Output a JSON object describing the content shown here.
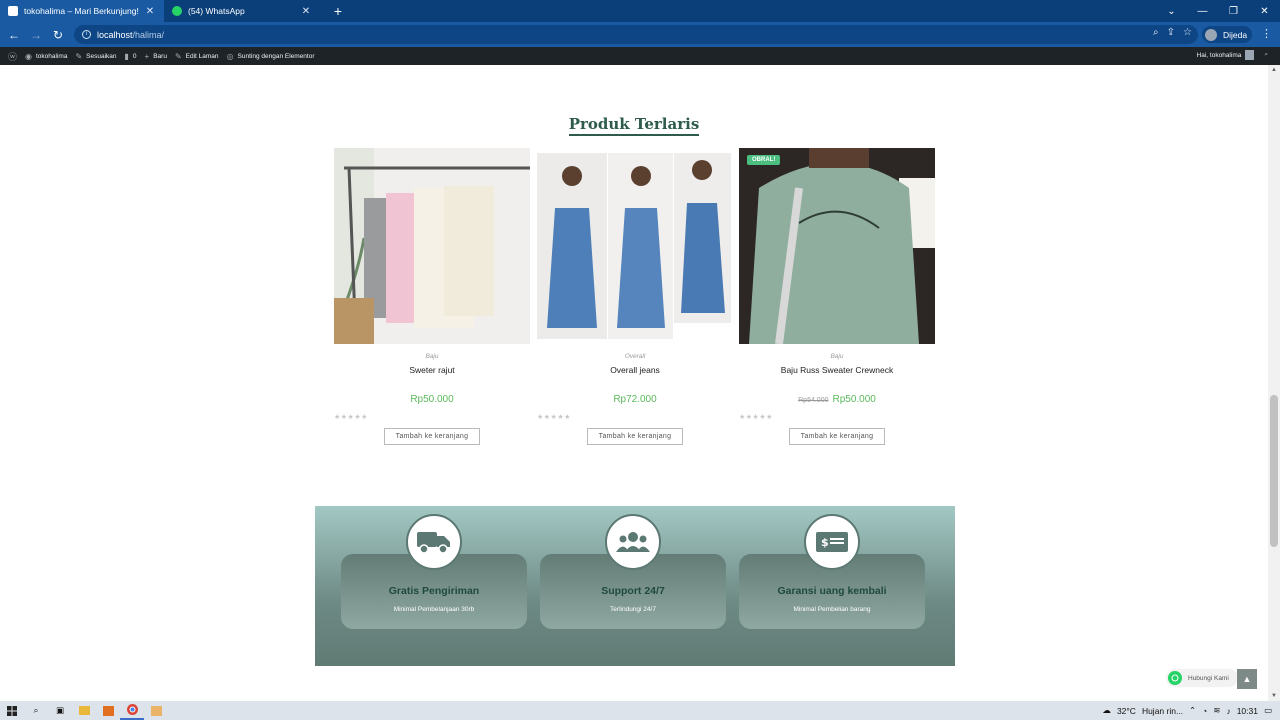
{
  "browser": {
    "tabs": [
      {
        "title": "tokohalima – Mari Berkunjung!",
        "active": true
      },
      {
        "title": "(54) WhatsApp",
        "active": false
      }
    ],
    "url_host": "localhost",
    "url_path": "/halima/",
    "profile_label": "Dijeda"
  },
  "admin_bar": {
    "site": "tokohalima",
    "customize": "Sesuaikan",
    "comments": "0",
    "new": "Baru",
    "edit": "Edit Laman",
    "elementor": "Sunting dengan Elementor",
    "greeting": "Hai, tokohalima"
  },
  "section": {
    "title": "Produk Terlaris"
  },
  "products": [
    {
      "category": "Baju",
      "name": "Sweter rajut",
      "price": "Rp50.000",
      "old_price": "",
      "rating": 0,
      "cart_label": "Tambah ke keranjang",
      "badge": ""
    },
    {
      "category": "Overall",
      "name": "Overall jeans",
      "price": "Rp72.000",
      "old_price": "",
      "rating": 0,
      "cart_label": "Tambah ke keranjang",
      "badge": ""
    },
    {
      "category": "Baju",
      "name": "Baju Russ Sweater Crewneck",
      "price": "Rp50.000",
      "old_price": "Rp54.000",
      "rating": 0,
      "cart_label": "Tambah ke keranjang",
      "badge": "OBRAL!"
    }
  ],
  "features": [
    {
      "icon": "truck-icon",
      "title": "Gratis Pengiriman",
      "subtitle": "Minimal Pembelanjaan 30rb"
    },
    {
      "icon": "users-icon",
      "title": "Support 24/7",
      "subtitle": "Terlindungi 24/7"
    },
    {
      "icon": "money-icon",
      "title": "Garansi uang kembali",
      "subtitle": "Minimal Pembelian barang"
    }
  ],
  "whatsapp": {
    "label": "Hubungi Kami"
  },
  "taskbar": {
    "weather": "32°C",
    "weather_text": "Hujan rin...",
    "time": "10:31"
  },
  "colors": {
    "accent": "#2e5b4b",
    "price": "#5cb85c",
    "badge": "#4cbf80",
    "browser": "#1a5aa2"
  }
}
